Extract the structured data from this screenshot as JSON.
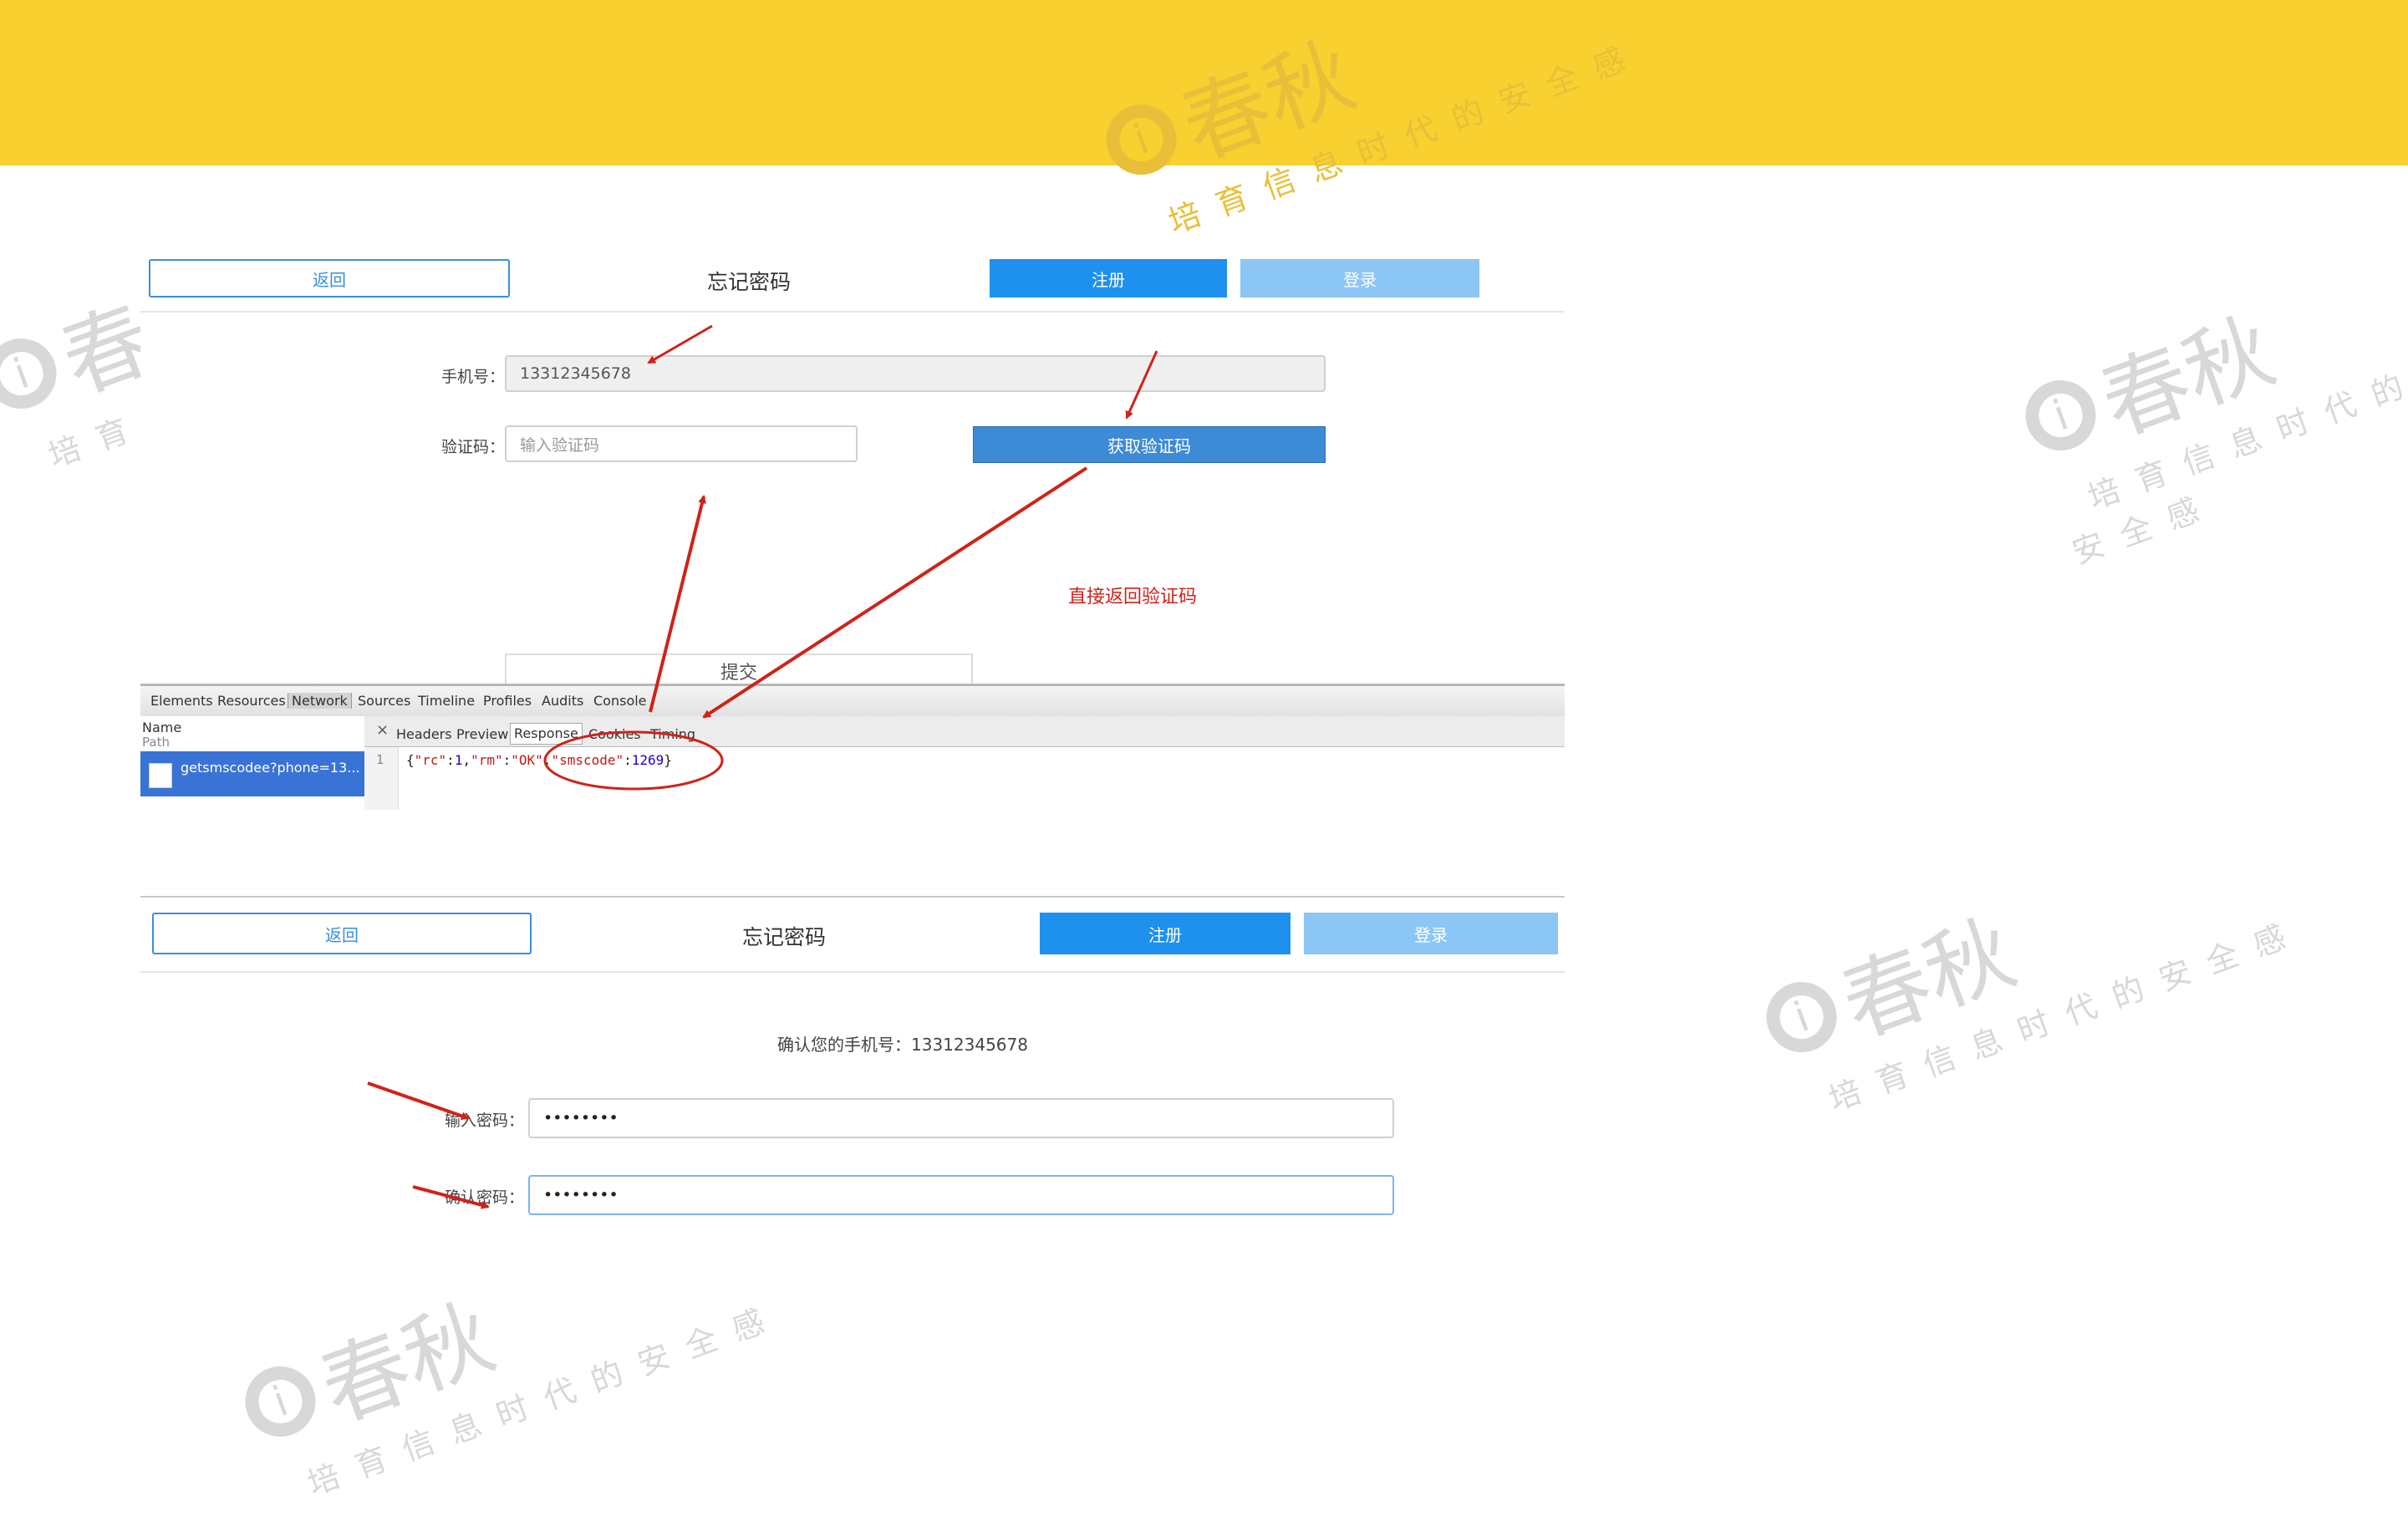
{
  "watermark": {
    "brand": "春秋",
    "slogan": "培育信息时代的安全感",
    "logo_letter": "i"
  },
  "panel1": {
    "back_label": "返回",
    "title": "忘记密码",
    "register_label": "注册",
    "login_label": "登录",
    "phone_label": "手机号：",
    "phone_value": "13312345678",
    "code_label": "验证码：",
    "code_placeholder": "输入验证码",
    "get_code_label": "获取验证码",
    "submit_label": "提交"
  },
  "annotation": {
    "note": "直接返回验证码",
    "color": "#d0221a"
  },
  "devtools": {
    "tabs": [
      "Elements",
      "Resources",
      "Network",
      "Sources",
      "Timeline",
      "Profiles",
      "Audits",
      "Console"
    ],
    "selected_tab": "Network",
    "name_header": "Name",
    "path_header": "Path",
    "request": "getsmscodee?phone=13...",
    "close_symbol": "×",
    "subtabs": [
      "Headers",
      "Preview",
      "Response",
      "Cookies",
      "Timing"
    ],
    "selected_subtab": "Response",
    "line_number": "1",
    "response": {
      "open": "{",
      "k1": "\"rc\"",
      "v1": "1",
      "k2": "\"rm\"",
      "v2": "\"OK\"",
      "k3": "\"smscode\"",
      "v3": "1269",
      "close": "}"
    }
  },
  "panel2": {
    "back_label": "返回",
    "title": "忘记密码",
    "register_label": "注册",
    "login_label": "登录",
    "confirm_text": "确认您的手机号：13312345678",
    "password_label": "输入密码：",
    "password_value": "••••••••",
    "confirm_label": "确认密码：",
    "confirm_value": "••••••••"
  },
  "colors": {
    "banner": "#f8d030",
    "primary": "#1e90ee",
    "light_primary": "#8cc6f5",
    "devtools_selection": "#3a73d6"
  }
}
